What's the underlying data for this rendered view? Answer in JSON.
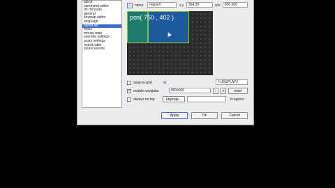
{
  "sidebar": {
    "items": [
      {
        "label": "about",
        "selected": false
      },
      {
        "label": "command editor",
        "selected": false
      },
      {
        "label": "do not pass",
        "selected": false
      },
      {
        "label": "general",
        "selected": false
      },
      {
        "label": "keymap editor",
        "selected": false
      },
      {
        "label": "language",
        "selected": false
      },
      {
        "label": "layout list",
        "selected": true
      },
      {
        "label": "macs",
        "selected": false
      },
      {
        "label": "mouse map",
        "selected": false
      },
      {
        "label": "override settings",
        "selected": false
      },
      {
        "label": "proxy settings",
        "selected": false
      },
      {
        "label": "round robin",
        "selected": false
      },
      {
        "label": "sound events",
        "selected": false
      }
    ]
  },
  "region": {
    "name_label": "name",
    "name_value": "region0",
    "xy_label": "x,y",
    "xy_value": "364,30",
    "wh_label": "w,h",
    "wh_value": "800,600"
  },
  "canvas": {
    "pos_text": "pos( 750 , 402 )"
  },
  "options": {
    "snap_label": "snap-to-grid",
    "snap_field_value": "no",
    "display_value": "\\\\.\\DISPLAY2",
    "navigator_label": "enable navigator",
    "navigator_value": "800x600",
    "navigator_checked": "✓",
    "reset_label": "reset",
    "always_label": "always on top",
    "keymap_label": "keymap...",
    "regions_count": "3 regions"
  },
  "footer": {
    "apply": "Apply",
    "ok": "Ok",
    "cancel": "Cancel"
  },
  "colors": {
    "canvas_bg": "#2c2c2c",
    "region_a": "#1e7a6a",
    "region_b": "#1c5a9c",
    "border_green": "#7fbe4a"
  }
}
